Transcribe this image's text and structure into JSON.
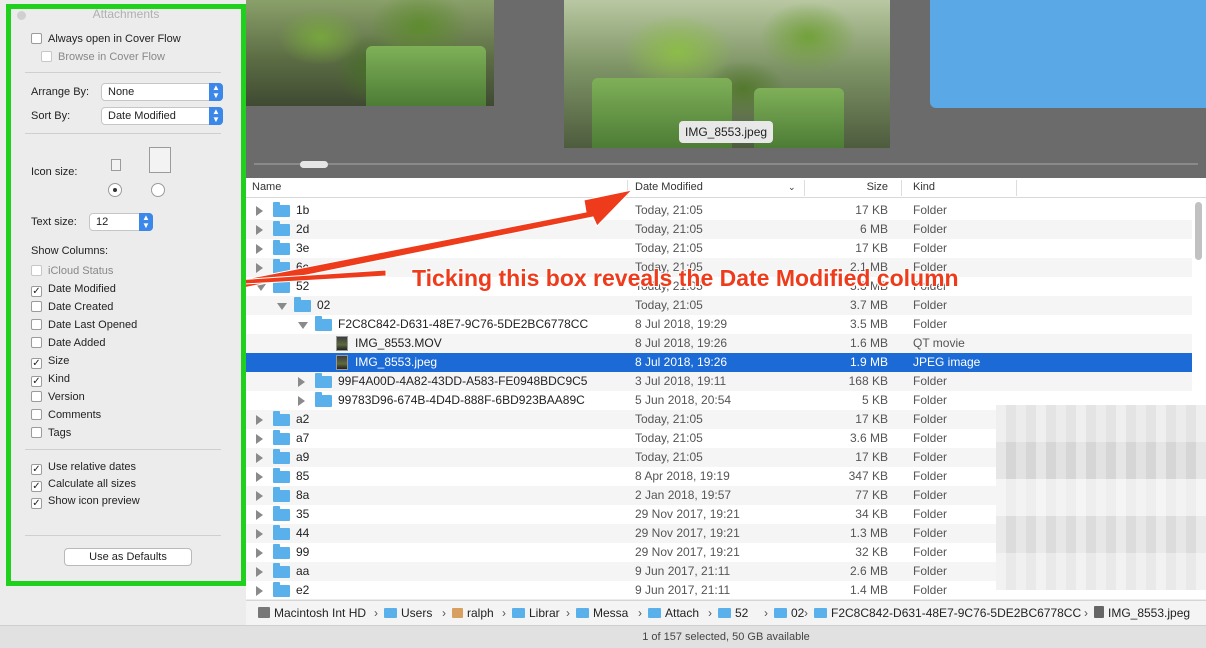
{
  "coverflow": {
    "caption": "IMG_8553.jpeg"
  },
  "columns": {
    "name": "Name",
    "date": "Date Modified",
    "size": "Size",
    "kind": "Kind"
  },
  "rows": [
    {
      "name": "1b",
      "date": "Today, 21:05",
      "size": "17 KB",
      "kind": "Folder",
      "level": 0,
      "disclosure": "closed",
      "icon": "folder-icon"
    },
    {
      "name": "2d",
      "date": "Today, 21:05",
      "size": "6 MB",
      "kind": "Folder",
      "level": 0,
      "disclosure": "closed",
      "icon": "folder-icon"
    },
    {
      "name": "3e",
      "date": "Today, 21:05",
      "size": "17 KB",
      "kind": "Folder",
      "level": 0,
      "disclosure": "closed",
      "icon": "folder-icon"
    },
    {
      "name": "6c",
      "date": "Today, 21:05",
      "size": "2.1 MB",
      "kind": "Folder",
      "level": 0,
      "disclosure": "closed",
      "icon": "folder-icon"
    },
    {
      "name": "52",
      "date": "Today, 21:05",
      "size": "5.3 MB",
      "kind": "Folder",
      "level": 0,
      "disclosure": "open",
      "icon": "folder-icon"
    },
    {
      "name": "02",
      "date": "Today, 21:05",
      "size": "3.7 MB",
      "kind": "Folder",
      "level": 1,
      "disclosure": "open",
      "icon": "folder-icon"
    },
    {
      "name": "F2C8C842-D631-48E7-9C76-5DE2BC6778CC",
      "date": "8 Jul 2018, 19:29",
      "size": "3.5 MB",
      "kind": "Folder",
      "level": 2,
      "disclosure": "open",
      "icon": "folder-icon"
    },
    {
      "name": "IMG_8553.MOV",
      "date": "8 Jul 2018, 19:26",
      "size": "1.6 MB",
      "kind": "QT movie",
      "level": 3,
      "disclosure": "none",
      "icon": "movie-icon"
    },
    {
      "name": "IMG_8553.jpeg",
      "date": "8 Jul 2018, 19:26",
      "size": "1.9 MB",
      "kind": "JPEG image",
      "level": 3,
      "disclosure": "none",
      "icon": "image-icon",
      "selected": true
    },
    {
      "name": "99F4A00D-4A82-43DD-A583-FE0948BDC9C5",
      "date": "3 Jul 2018, 19:11",
      "size": "168 KB",
      "kind": "Folder",
      "level": 2,
      "disclosure": "closed",
      "icon": "folder-icon"
    },
    {
      "name": "99783D96-674B-4D4D-888F-6BD923BAA89C",
      "date": "5 Jun 2018, 20:54",
      "size": "5 KB",
      "kind": "Folder",
      "level": 2,
      "disclosure": "closed",
      "icon": "folder-icon"
    },
    {
      "name": "a2",
      "date": "Today, 21:05",
      "size": "17 KB",
      "kind": "Folder",
      "level": 0,
      "disclosure": "closed",
      "icon": "folder-icon"
    },
    {
      "name": "a7",
      "date": "Today, 21:05",
      "size": "3.6 MB",
      "kind": "Folder",
      "level": 0,
      "disclosure": "closed",
      "icon": "folder-icon"
    },
    {
      "name": "a9",
      "date": "Today, 21:05",
      "size": "17 KB",
      "kind": "Folder",
      "level": 0,
      "disclosure": "closed",
      "icon": "folder-icon"
    },
    {
      "name": "85",
      "date": "8 Apr 2018, 19:19",
      "size": "347 KB",
      "kind": "Folder",
      "level": 0,
      "disclosure": "closed",
      "icon": "folder-icon"
    },
    {
      "name": "8a",
      "date": "2 Jan 2018, 19:57",
      "size": "77 KB",
      "kind": "Folder",
      "level": 0,
      "disclosure": "closed",
      "icon": "folder-icon"
    },
    {
      "name": "35",
      "date": "29 Nov 2017, 19:21",
      "size": "34 KB",
      "kind": "Folder",
      "level": 0,
      "disclosure": "closed",
      "icon": "folder-icon"
    },
    {
      "name": "44",
      "date": "29 Nov 2017, 19:21",
      "size": "1.3 MB",
      "kind": "Folder",
      "level": 0,
      "disclosure": "closed",
      "icon": "folder-icon"
    },
    {
      "name": "99",
      "date": "29 Nov 2017, 19:21",
      "size": "32 KB",
      "kind": "Folder",
      "level": 0,
      "disclosure": "closed",
      "icon": "folder-icon"
    },
    {
      "name": "aa",
      "date": "9 Jun 2017, 21:11",
      "size": "2.6 MB",
      "kind": "Folder",
      "level": 0,
      "disclosure": "closed",
      "icon": "folder-icon"
    },
    {
      "name": "e2",
      "date": "9 Jun 2017, 21:11",
      "size": "1.4 MB",
      "kind": "Folder",
      "level": 0,
      "disclosure": "closed",
      "icon": "folder-icon"
    }
  ],
  "pathbar": [
    {
      "label": "Macintosh Int HD",
      "icon": "drive-icon"
    },
    {
      "label": "Users",
      "icon": "folder-icon"
    },
    {
      "label": "ralph",
      "icon": "home-icon"
    },
    {
      "label": "Librar",
      "icon": "folder-icon"
    },
    {
      "label": "Messa",
      "icon": "folder-icon"
    },
    {
      "label": "Attach",
      "icon": "folder-icon"
    },
    {
      "label": "52",
      "icon": "folder-icon"
    },
    {
      "label": "02",
      "icon": "folder-icon"
    },
    {
      "label": "F2C8C842-D631-48E7-9C76-5DE2BC6778CC",
      "icon": "folder-icon"
    },
    {
      "label": "IMG_8553.jpeg",
      "icon": "image-icon"
    }
  ],
  "status": "1 of 157 selected, 50 GB available",
  "annotation": "Ticking this box reveals the Date Modified column",
  "view_options": {
    "title": "Attachments",
    "always_cover_flow": {
      "label": "Always open in Cover Flow",
      "checked": false
    },
    "browse_cover_flow": {
      "label": "Browse in Cover Flow",
      "checked": false,
      "disabled": true
    },
    "arrange_by": {
      "label": "Arrange By:",
      "value": "None"
    },
    "sort_by": {
      "label": "Sort By:",
      "value": "Date Modified"
    },
    "icon_size_label": "Icon size:",
    "text_size": {
      "label": "Text size:",
      "value": "12"
    },
    "show_columns_label": "Show Columns:",
    "columns": [
      {
        "label": "iCloud Status",
        "checked": false,
        "disabled": true
      },
      {
        "label": "Date Modified",
        "checked": true
      },
      {
        "label": "Date Created",
        "checked": false
      },
      {
        "label": "Date Last Opened",
        "checked": false
      },
      {
        "label": "Date Added",
        "checked": false
      },
      {
        "label": "Size",
        "checked": true
      },
      {
        "label": "Kind",
        "checked": true
      },
      {
        "label": "Version",
        "checked": false
      },
      {
        "label": "Comments",
        "checked": false
      },
      {
        "label": "Tags",
        "checked": false
      }
    ],
    "options": [
      {
        "label": "Use relative dates",
        "checked": true
      },
      {
        "label": "Calculate all sizes",
        "checked": true
      },
      {
        "label": "Show icon preview",
        "checked": true
      }
    ],
    "defaults_button": "Use as Defaults"
  },
  "colors": {
    "highlight_border": "#1fd11d",
    "annotation": "#ee3b1c",
    "selection": "#1b6ad6",
    "folder": "#59b0ea"
  }
}
